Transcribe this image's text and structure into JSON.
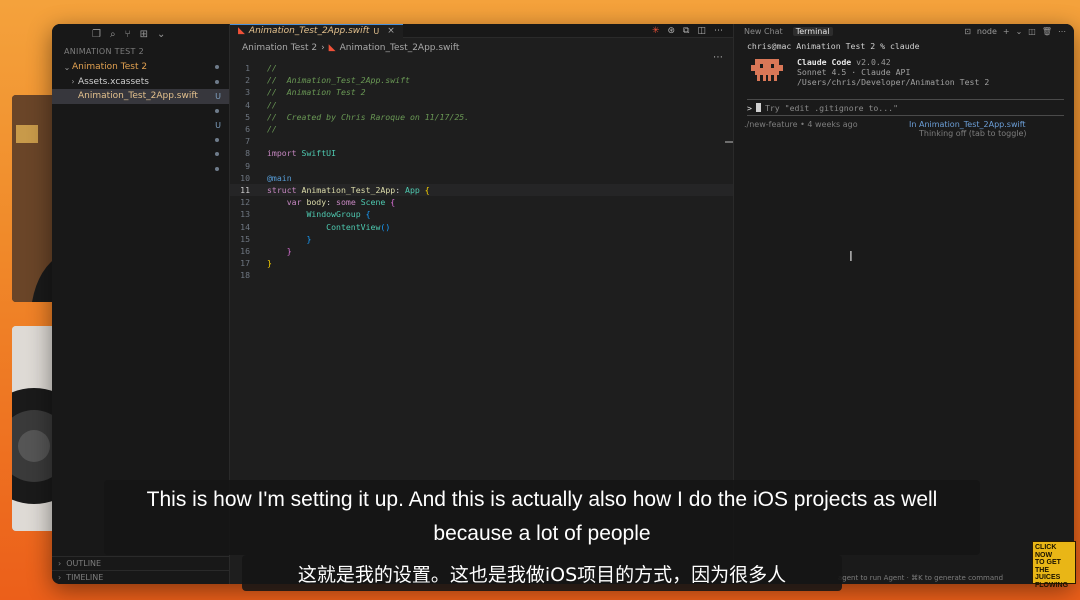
{
  "sidebar": {
    "section_title": "ANIMATION TEST 2",
    "items": [
      {
        "label": "Animation Test 2",
        "badge": ""
      },
      {
        "label": "Assets.xcassets",
        "badge": ""
      },
      {
        "label": "Animation_Test_2App.swift",
        "badge": "U"
      }
    ],
    "bottom_sections": [
      "OUTLINE",
      "TIMELINE"
    ]
  },
  "editor": {
    "tab": {
      "label": "Animation_Test_2App.swift",
      "badge": "U"
    },
    "breadcrumb": [
      "Animation Test 2",
      "Animation_Test_2App.swift"
    ],
    "current_line": 11,
    "lines": [
      "//",
      "//  Animation_Test_2App.swift",
      "//  Animation Test 2",
      "//",
      "//  Created by Chris Raroque on 11/17/25.",
      "//",
      "",
      "import SwiftUI",
      "",
      "@main",
      "struct Animation_Test_2App: App {",
      "    var body: some Scene {",
      "        WindowGroup {",
      "            ContentView()",
      "        }",
      "    }",
      "}",
      ""
    ]
  },
  "panel": {
    "tabs": [
      "New Chat",
      "Terminal"
    ],
    "active_tab": "Terminal",
    "shell_label": "node",
    "prompt": "chris@mac Animation Test 2 % claude",
    "claude": {
      "name": "Claude Code",
      "version": "v2.0.42",
      "model": "Sonnet 4.5 · Claude API",
      "path": "/Users/chris/Developer/Animation Test 2"
    },
    "input_placeholder": "Try \"edit .gitignore to...\"",
    "branch": "./new-feature • 4 weeks ago",
    "context": "In Animation_Test_2App.swift",
    "thinking": "Thinking off (tab to toggle)",
    "hint": "agent to run Agent · ⌘K to generate command"
  },
  "subtitles": {
    "en_line1": "This is how I'm setting it up. And this is actually also how I do the iOS projects as well",
    "en_line2": "because a lot of people",
    "zh": "这就是我的设置。这也是我做iOS项目的方式，因为很多人"
  },
  "logo": {
    "lines": [
      "CLICK NOW",
      "TO GET",
      "THE",
      "JUICES",
      "FLOWING"
    ]
  },
  "colors": {
    "background_top": "#f4a23c",
    "background_bottom": "#ec5f1a",
    "editor_bg": "#1e1e1e",
    "swift_orange": "#f05138",
    "claude_mascot": "#d97757"
  }
}
